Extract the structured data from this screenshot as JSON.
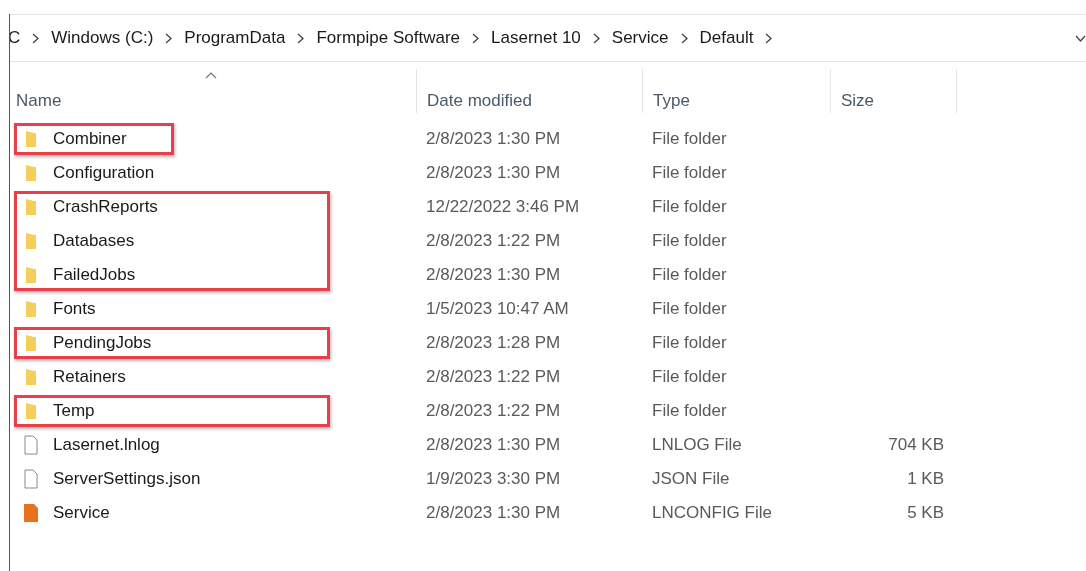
{
  "breadcrumb": [
    "C",
    "Windows (C:)",
    "ProgramData",
    "Formpipe Software",
    "Lasernet 10",
    "Service",
    "Default"
  ],
  "columns": [
    "Name",
    "Date modified",
    "Type",
    "Size"
  ],
  "rows": [
    {
      "name": "Combiner",
      "date": "2/8/2023 1:30 PM",
      "type": "File folder",
      "kind": "folder",
      "highlighted": true,
      "narrow_highlight": true
    },
    {
      "name": "Configuration",
      "date": "2/8/2023 1:30 PM",
      "type": "File folder",
      "kind": "folder",
      "highlighted": false
    },
    {
      "name": "CrashReports",
      "date": "12/22/2022 3:46 PM",
      "type": "File folder",
      "kind": "folder",
      "highlighted": true,
      "narrow_highlight": false
    },
    {
      "name": "Databases",
      "date": "2/8/2023 1:22 PM",
      "type": "File folder",
      "kind": "folder",
      "highlighted": true,
      "narrow_highlight": false
    },
    {
      "name": "FailedJobs",
      "date": "2/8/2023 1:30 PM",
      "type": "File folder",
      "kind": "folder",
      "highlighted": true,
      "narrow_highlight": false
    },
    {
      "name": "Fonts",
      "date": "1/5/2023 10:47 AM",
      "type": "File folder",
      "kind": "folder",
      "highlighted": false
    },
    {
      "name": "PendingJobs",
      "date": "2/8/2023 1:28 PM",
      "type": "File folder",
      "kind": "folder",
      "highlighted": true,
      "narrow_highlight": false
    },
    {
      "name": "Retainers",
      "date": "2/8/2023 1:22 PM",
      "type": "File folder",
      "kind": "folder",
      "highlighted": false
    },
    {
      "name": "Temp",
      "date": "2/8/2023 1:22 PM",
      "type": "File folder",
      "kind": "folder",
      "highlighted": true,
      "narrow_highlight": false
    },
    {
      "name": "Lasernet.lnlog",
      "date": "2/8/2023 1:30 PM",
      "type": "LNLOG File",
      "size": "704 KB",
      "kind": "file",
      "highlighted": false
    },
    {
      "name": "ServerSettings.json",
      "date": "1/9/2023 3:30 PM",
      "type": "JSON File",
      "size": "1 KB",
      "kind": "file",
      "highlighted": false
    },
    {
      "name": "Service",
      "date": "2/8/2023 1:30 PM",
      "type": "LNCONFIG File",
      "size": "5 KB",
      "kind": "config",
      "highlighted": false
    }
  ]
}
